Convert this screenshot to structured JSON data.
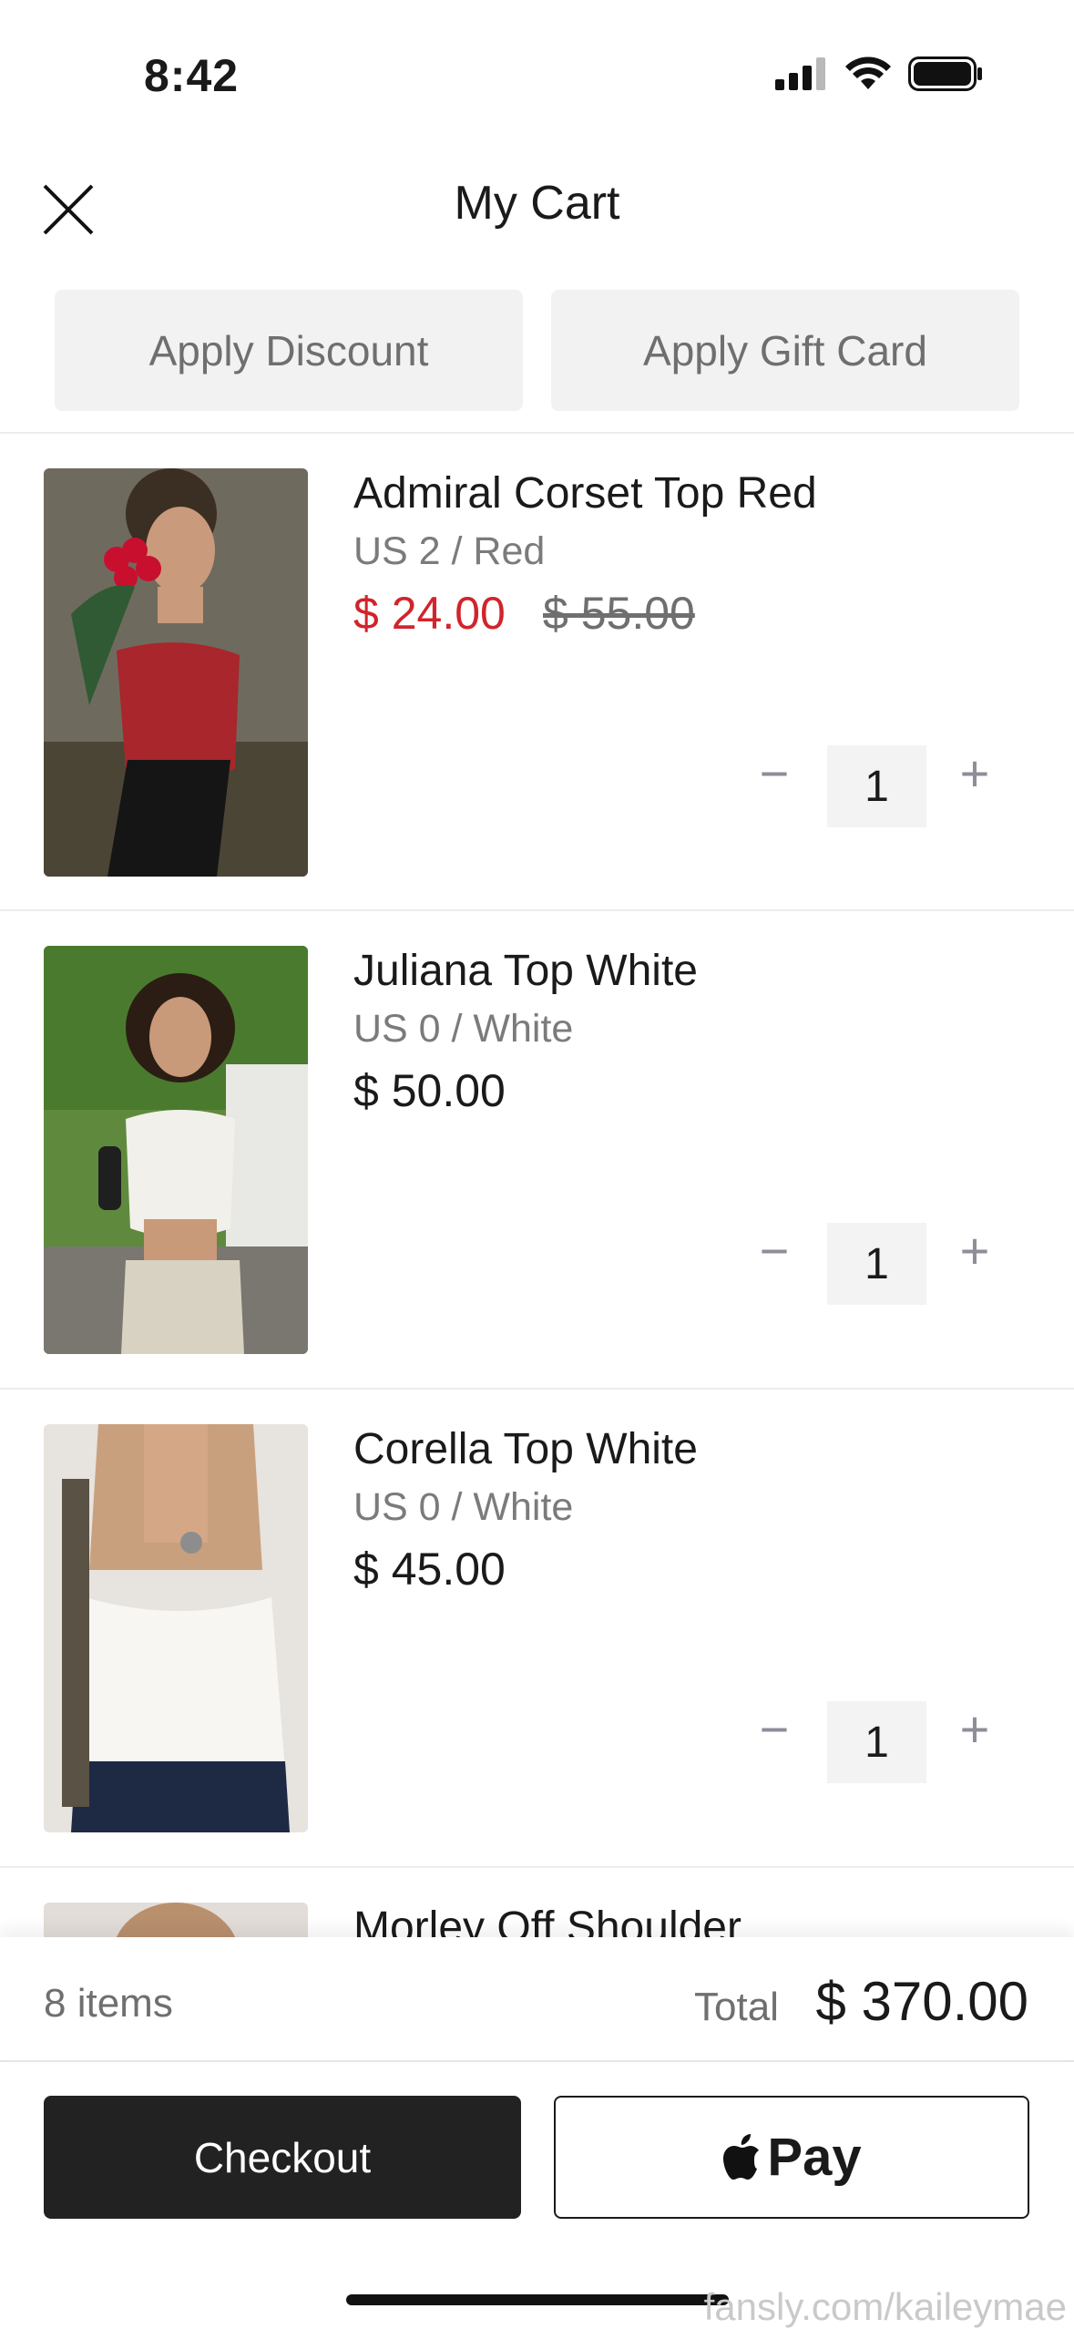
{
  "status_bar": {
    "time": "8:42"
  },
  "header": {
    "title": "My Cart"
  },
  "actions": {
    "discount_label": "Apply Discount",
    "gift_card_label": "Apply Gift Card"
  },
  "items": [
    {
      "name": "Admiral Corset Top Red",
      "variant": "US 2 / Red",
      "price": "$ 24.00",
      "compare_price": "$ 55.00",
      "quantity": "1",
      "qty_minus": "−",
      "qty_plus": "+"
    },
    {
      "name": "Juliana Top White",
      "variant": "US 0 / White",
      "price": "$ 50.00",
      "quantity": "1",
      "qty_minus": "−",
      "qty_plus": "+"
    },
    {
      "name": "Corella Top White",
      "variant": "US 0 / White",
      "price": "$ 45.00",
      "quantity": "1",
      "qty_minus": "−",
      "qty_plus": "+"
    },
    {
      "name": "Morley Off Shoulder"
    }
  ],
  "summary": {
    "items_count": "8 items",
    "total_label": "Total",
    "total_value": "$ 370.00"
  },
  "buttons": {
    "checkout_label": "Checkout",
    "apple_pay_label": "Pay"
  },
  "watermark": "fansly.com/kaileymae",
  "colors": {
    "sale_price": "#d1242b",
    "checkout_bg": "#222222",
    "action_bg": "#f2f2f2"
  }
}
